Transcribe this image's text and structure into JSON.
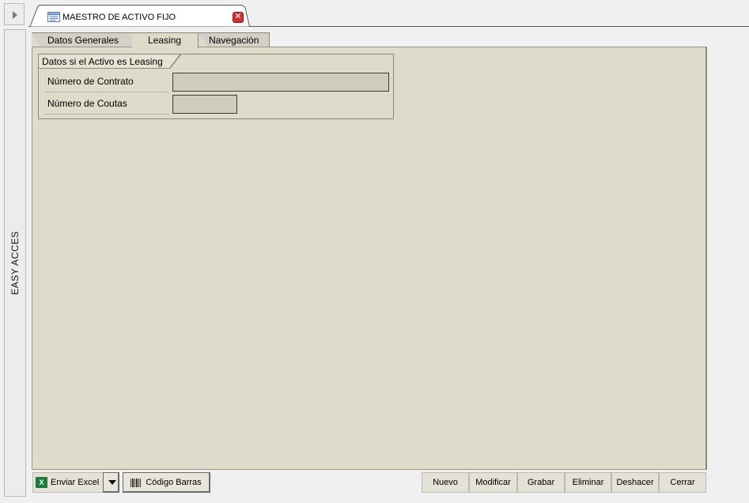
{
  "sidebar": {
    "label": "EASY ACCES"
  },
  "document_tab": {
    "title": "MAESTRO DE ACTIVO FIJO",
    "icon": "form-window-icon",
    "close_icon": "close-icon"
  },
  "tabs": [
    {
      "label": "Datos Generales",
      "active": false
    },
    {
      "label": "Leasing",
      "active": true
    },
    {
      "label": "Navegación",
      "active": false
    }
  ],
  "group": {
    "title": "Datos si el Activo es Leasing",
    "fields": [
      {
        "label": "Número de Contrato",
        "value": ""
      },
      {
        "label": "Número de Coutas",
        "value": ""
      }
    ]
  },
  "toolbar": {
    "excel_label": "Enviar Excel",
    "barcode_label": "Código Barras",
    "nuevo": "Nuevo",
    "modificar": "Modificar",
    "grabar": "Grabar",
    "eliminar": "Eliminar",
    "deshacer": "Deshacer",
    "cerrar": "Cerrar"
  },
  "colors": {
    "panel": "#dfdbca",
    "field": "#cfcbbd",
    "close": "#d32f2f",
    "excel": "#1d7a3a"
  }
}
